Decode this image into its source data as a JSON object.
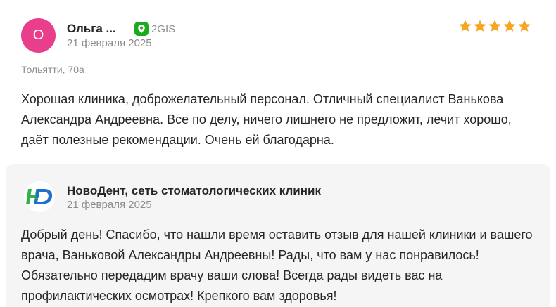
{
  "review": {
    "avatar_letter": "О",
    "author_name": "Ольга ...",
    "source_label": "2GIS",
    "date": "21 февраля 2025",
    "rating": 5,
    "location": "Тольятти, 70а",
    "text": "Хорошая клиника, доброжелательный персонал. Отличный специалист Ванькова Александра Андреевна. Все по делу, ничего лишнего не предложит, лечит хорошо, даёт полезные рекомендации. Очень ей благодарна."
  },
  "reply": {
    "org_name": "НовоДент, сеть стоматологических клиник",
    "date": "21 февраля 2025",
    "text": "Добрый день! Спасибо, что нашли время оставить отзыв для нашей клиники и вашего врача, Ваньковой Александры Андреевны! Рады, что вам у нас понравилось! Обязательно передадим врачу ваши слова! Всегда рады видеть вас на профилактических осмотрах! Крепкого вам здоровья!"
  },
  "colors": {
    "avatar_bg": "#e83e8c",
    "star": "#f5a623",
    "gis_green": "#19aa1e",
    "logo_blue": "#1f6fd1",
    "logo_green": "#2fb34a"
  }
}
